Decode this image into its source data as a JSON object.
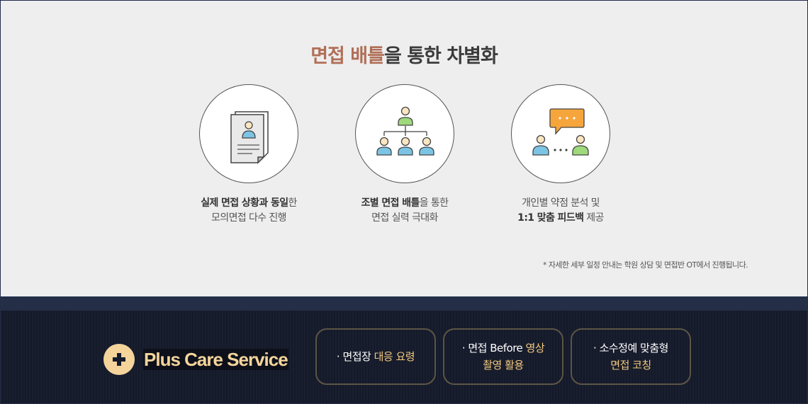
{
  "headline": {
    "accent": "면접 배틀",
    "rest": "을 통한 차별화"
  },
  "features": [
    {
      "icon": "resume-document-icon",
      "line1_bold": "실제 면접 상황과 동일",
      "line1_rest": "한",
      "line2": "모의면접 다수 진행"
    },
    {
      "icon": "group-hierarchy-icon",
      "line1_bold": "조별 면접 배틀",
      "line1_rest": "을 통한",
      "line2": "면접 실력 극대화"
    },
    {
      "icon": "feedback-chat-icon",
      "line1": "개인별 약점 분석 및",
      "line2_bold": "1:1 맞춤 피드백",
      "line2_rest": " 제공"
    }
  ],
  "note": "* 자세한 세부 일정 안내는 학원 상담 및 면접반 OT에서 진행됩니다.",
  "plus_care": {
    "label": "Plus Care Service",
    "icon": "plus-circle-icon"
  },
  "services": [
    {
      "pre": "· 면접장 ",
      "hl": "대응 요령",
      "line2": ""
    },
    {
      "pre": "· 면접 Before ",
      "hl": "영상",
      "line2": "촬영 활용"
    },
    {
      "pre": "· 소수정예 맞춤형",
      "hl": "",
      "line2": "면접 코칭"
    }
  ],
  "colors": {
    "accent": "#b06f57",
    "gold": "#f4d49b",
    "navy": "#141a2a",
    "icon_blue": "#7cc4e4",
    "icon_green": "#9ed97c",
    "icon_orange": "#f6a53c"
  }
}
